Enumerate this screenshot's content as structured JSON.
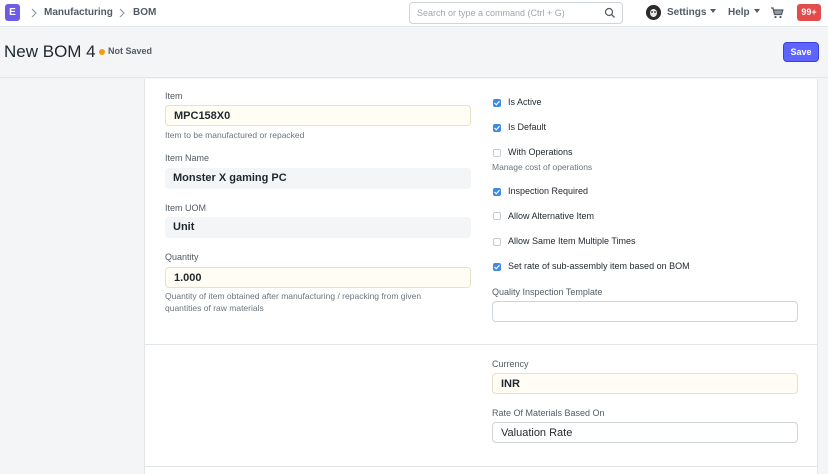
{
  "navbar": {
    "logo": "E",
    "breadcrumbs": [
      "Manufacturing",
      "BOM"
    ],
    "search_placeholder": "Search or type a command (Ctrl + G)",
    "settings_label": "Settings",
    "help_label": "Help",
    "notification_count": "99+"
  },
  "page": {
    "title": "New BOM 4",
    "status": "Not Saved",
    "save_label": "Save"
  },
  "form": {
    "item": {
      "label": "Item",
      "value": "MPC158X0",
      "description": "Item to be manufactured or repacked"
    },
    "item_name": {
      "label": "Item Name",
      "value": "Monster X gaming PC"
    },
    "item_uom": {
      "label": "Item UOM",
      "value": "Unit"
    },
    "quantity": {
      "label": "Quantity",
      "value": "1.000",
      "description_line1": "Quantity of item obtained after manufacturing / repacking from given",
      "description_line2": "quantities of raw materials"
    },
    "checkboxes": [
      {
        "label": "Is Active",
        "checked": true
      },
      {
        "label": "Is Default",
        "checked": true
      },
      {
        "label": "With Operations",
        "checked": false
      },
      {
        "label": "Inspection Required",
        "checked": true
      },
      {
        "label": "Allow Alternative Item",
        "checked": false
      },
      {
        "label": "Allow Same Item Multiple Times",
        "checked": false
      },
      {
        "label": "Set rate of sub-assembly item based on BOM",
        "checked": true
      }
    ],
    "operations_description": "Manage cost of operations",
    "quality_template": {
      "label": "Quality Inspection Template",
      "value": ""
    },
    "currency": {
      "label": "Currency",
      "value": "INR"
    },
    "rate_based_on": {
      "label": "Rate Of Materials Based On",
      "value": "Valuation Rate"
    }
  },
  "colors": {
    "primary": "#5e64ff",
    "checkbox": "#3c8ae8",
    "not_saved_dot": "#f39c12",
    "notification": "#e24c4c"
  }
}
